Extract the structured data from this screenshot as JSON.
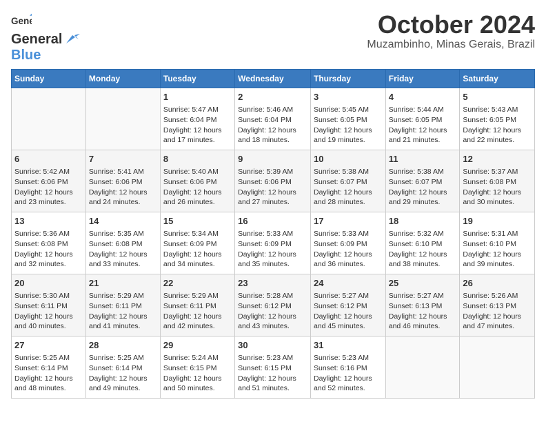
{
  "logo": {
    "general": "General",
    "blue": "Blue"
  },
  "title": {
    "month": "October 2024",
    "location": "Muzambinho, Minas Gerais, Brazil"
  },
  "days_of_week": [
    "Sunday",
    "Monday",
    "Tuesday",
    "Wednesday",
    "Thursday",
    "Friday",
    "Saturday"
  ],
  "weeks": [
    [
      {
        "day": "",
        "sunrise": "",
        "sunset": "",
        "daylight": ""
      },
      {
        "day": "",
        "sunrise": "",
        "sunset": "",
        "daylight": ""
      },
      {
        "day": "1",
        "sunrise": "Sunrise: 5:47 AM",
        "sunset": "Sunset: 6:04 PM",
        "daylight": "Daylight: 12 hours and 17 minutes."
      },
      {
        "day": "2",
        "sunrise": "Sunrise: 5:46 AM",
        "sunset": "Sunset: 6:04 PM",
        "daylight": "Daylight: 12 hours and 18 minutes."
      },
      {
        "day": "3",
        "sunrise": "Sunrise: 5:45 AM",
        "sunset": "Sunset: 6:05 PM",
        "daylight": "Daylight: 12 hours and 19 minutes."
      },
      {
        "day": "4",
        "sunrise": "Sunrise: 5:44 AM",
        "sunset": "Sunset: 6:05 PM",
        "daylight": "Daylight: 12 hours and 21 minutes."
      },
      {
        "day": "5",
        "sunrise": "Sunrise: 5:43 AM",
        "sunset": "Sunset: 6:05 PM",
        "daylight": "Daylight: 12 hours and 22 minutes."
      }
    ],
    [
      {
        "day": "6",
        "sunrise": "Sunrise: 5:42 AM",
        "sunset": "Sunset: 6:06 PM",
        "daylight": "Daylight: 12 hours and 23 minutes."
      },
      {
        "day": "7",
        "sunrise": "Sunrise: 5:41 AM",
        "sunset": "Sunset: 6:06 PM",
        "daylight": "Daylight: 12 hours and 24 minutes."
      },
      {
        "day": "8",
        "sunrise": "Sunrise: 5:40 AM",
        "sunset": "Sunset: 6:06 PM",
        "daylight": "Daylight: 12 hours and 26 minutes."
      },
      {
        "day": "9",
        "sunrise": "Sunrise: 5:39 AM",
        "sunset": "Sunset: 6:06 PM",
        "daylight": "Daylight: 12 hours and 27 minutes."
      },
      {
        "day": "10",
        "sunrise": "Sunrise: 5:38 AM",
        "sunset": "Sunset: 6:07 PM",
        "daylight": "Daylight: 12 hours and 28 minutes."
      },
      {
        "day": "11",
        "sunrise": "Sunrise: 5:38 AM",
        "sunset": "Sunset: 6:07 PM",
        "daylight": "Daylight: 12 hours and 29 minutes."
      },
      {
        "day": "12",
        "sunrise": "Sunrise: 5:37 AM",
        "sunset": "Sunset: 6:08 PM",
        "daylight": "Daylight: 12 hours and 30 minutes."
      }
    ],
    [
      {
        "day": "13",
        "sunrise": "Sunrise: 5:36 AM",
        "sunset": "Sunset: 6:08 PM",
        "daylight": "Daylight: 12 hours and 32 minutes."
      },
      {
        "day": "14",
        "sunrise": "Sunrise: 5:35 AM",
        "sunset": "Sunset: 6:08 PM",
        "daylight": "Daylight: 12 hours and 33 minutes."
      },
      {
        "day": "15",
        "sunrise": "Sunrise: 5:34 AM",
        "sunset": "Sunset: 6:09 PM",
        "daylight": "Daylight: 12 hours and 34 minutes."
      },
      {
        "day": "16",
        "sunrise": "Sunrise: 5:33 AM",
        "sunset": "Sunset: 6:09 PM",
        "daylight": "Daylight: 12 hours and 35 minutes."
      },
      {
        "day": "17",
        "sunrise": "Sunrise: 5:33 AM",
        "sunset": "Sunset: 6:09 PM",
        "daylight": "Daylight: 12 hours and 36 minutes."
      },
      {
        "day": "18",
        "sunrise": "Sunrise: 5:32 AM",
        "sunset": "Sunset: 6:10 PM",
        "daylight": "Daylight: 12 hours and 38 minutes."
      },
      {
        "day": "19",
        "sunrise": "Sunrise: 5:31 AM",
        "sunset": "Sunset: 6:10 PM",
        "daylight": "Daylight: 12 hours and 39 minutes."
      }
    ],
    [
      {
        "day": "20",
        "sunrise": "Sunrise: 5:30 AM",
        "sunset": "Sunset: 6:11 PM",
        "daylight": "Daylight: 12 hours and 40 minutes."
      },
      {
        "day": "21",
        "sunrise": "Sunrise: 5:29 AM",
        "sunset": "Sunset: 6:11 PM",
        "daylight": "Daylight: 12 hours and 41 minutes."
      },
      {
        "day": "22",
        "sunrise": "Sunrise: 5:29 AM",
        "sunset": "Sunset: 6:11 PM",
        "daylight": "Daylight: 12 hours and 42 minutes."
      },
      {
        "day": "23",
        "sunrise": "Sunrise: 5:28 AM",
        "sunset": "Sunset: 6:12 PM",
        "daylight": "Daylight: 12 hours and 43 minutes."
      },
      {
        "day": "24",
        "sunrise": "Sunrise: 5:27 AM",
        "sunset": "Sunset: 6:12 PM",
        "daylight": "Daylight: 12 hours and 45 minutes."
      },
      {
        "day": "25",
        "sunrise": "Sunrise: 5:27 AM",
        "sunset": "Sunset: 6:13 PM",
        "daylight": "Daylight: 12 hours and 46 minutes."
      },
      {
        "day": "26",
        "sunrise": "Sunrise: 5:26 AM",
        "sunset": "Sunset: 6:13 PM",
        "daylight": "Daylight: 12 hours and 47 minutes."
      }
    ],
    [
      {
        "day": "27",
        "sunrise": "Sunrise: 5:25 AM",
        "sunset": "Sunset: 6:14 PM",
        "daylight": "Daylight: 12 hours and 48 minutes."
      },
      {
        "day": "28",
        "sunrise": "Sunrise: 5:25 AM",
        "sunset": "Sunset: 6:14 PM",
        "daylight": "Daylight: 12 hours and 49 minutes."
      },
      {
        "day": "29",
        "sunrise": "Sunrise: 5:24 AM",
        "sunset": "Sunset: 6:15 PM",
        "daylight": "Daylight: 12 hours and 50 minutes."
      },
      {
        "day": "30",
        "sunrise": "Sunrise: 5:23 AM",
        "sunset": "Sunset: 6:15 PM",
        "daylight": "Daylight: 12 hours and 51 minutes."
      },
      {
        "day": "31",
        "sunrise": "Sunrise: 5:23 AM",
        "sunset": "Sunset: 6:16 PM",
        "daylight": "Daylight: 12 hours and 52 minutes."
      },
      {
        "day": "",
        "sunrise": "",
        "sunset": "",
        "daylight": ""
      },
      {
        "day": "",
        "sunrise": "",
        "sunset": "",
        "daylight": ""
      }
    ]
  ]
}
